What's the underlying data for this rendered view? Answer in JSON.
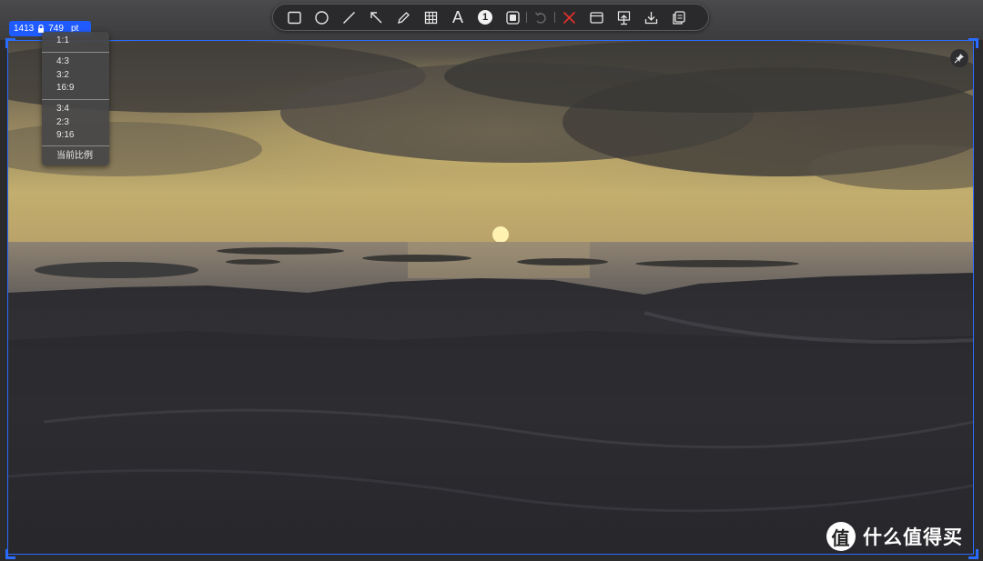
{
  "selection": {
    "width": "1413",
    "height": "749",
    "unit": "pt"
  },
  "toolbar": {
    "tools": [
      {
        "name": "rectangle-icon"
      },
      {
        "name": "ellipse-icon"
      },
      {
        "name": "line-icon"
      },
      {
        "name": "arrow-icon"
      },
      {
        "name": "pencil-icon"
      },
      {
        "name": "mosaic-icon"
      },
      {
        "name": "text-icon",
        "label": "A"
      },
      {
        "name": "number-marker-icon",
        "label": "1"
      },
      {
        "name": "highlight-box-icon"
      }
    ],
    "undo": "undo-icon",
    "close": "close-icon",
    "actions": [
      "window-icon",
      "upload-icon",
      "download-icon",
      "copy-icon"
    ],
    "accent_close": "#e0302a"
  },
  "ratio_menu": {
    "items": [
      "1:1",
      "4:3",
      "3:2",
      "16:9",
      "3:4",
      "2:3",
      "9:16",
      "当前比例"
    ]
  },
  "watermark": {
    "logo_char": "值",
    "text": "什么值得买"
  },
  "colors": {
    "selection": "#2a6cff",
    "badge": "#1f5bff"
  }
}
